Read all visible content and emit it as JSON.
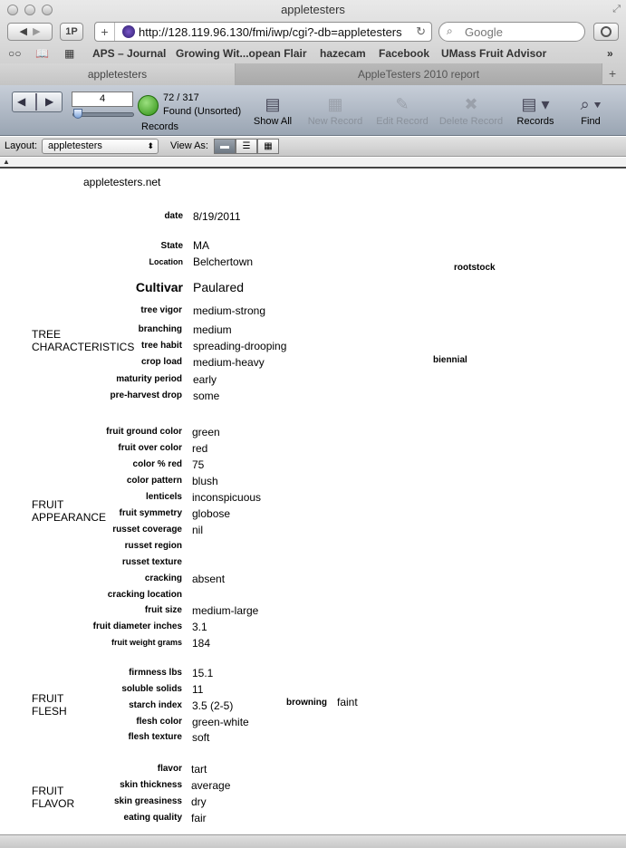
{
  "window": {
    "title": "appletesters"
  },
  "browser": {
    "address": "http://128.119.96.130/fmi/iwp/cgi?-db=appletesters",
    "search_placeholder": "Google",
    "password_button": "1P",
    "add_button": "+",
    "bookmarks": [
      "APS – Journal",
      "Growing Wit...opean Flair",
      "hazecam",
      "Facebook",
      "UMass Fruit Advisor"
    ],
    "tabs": [
      {
        "label": "appletesters",
        "active": true
      },
      {
        "label": "AppleTesters 2010 report",
        "active": false
      }
    ]
  },
  "toolbar": {
    "record_number": "4",
    "found": "72 / 317",
    "found_status": "Found (Unsorted)",
    "records_label": "Records",
    "buttons": [
      {
        "label": "Show All",
        "enabled": true
      },
      {
        "label": "New Record",
        "enabled": false
      },
      {
        "label": "Edit Record",
        "enabled": false
      },
      {
        "label": "Delete Record",
        "enabled": false
      },
      {
        "label": "Records",
        "enabled": true
      },
      {
        "label": "Find",
        "enabled": true
      }
    ]
  },
  "layout_bar": {
    "layout_label": "Layout:",
    "layout_value": "appletesters",
    "view_as_label": "View As:"
  },
  "record": {
    "site": "appletesters.net",
    "date_label": "date",
    "date": "8/19/2011",
    "state_label": "State",
    "state": "MA",
    "location_label": "Location",
    "location": "Belchertown",
    "rootstock_label": "rootstock",
    "cultivar_label": "Cultivar",
    "cultivar": "Paulared",
    "biennial_label": "biennial",
    "browning_label": "browning",
    "browning": "faint",
    "sections": {
      "tree": "TREE\nCHARACTERISTICS",
      "appearance": "FRUIT\nAPPEARANCE",
      "flesh": "FRUIT\nFLESH",
      "flavor": "FRUIT\nFLAVOR"
    },
    "tree": [
      {
        "label": "tree vigor",
        "value": "medium-strong"
      },
      {
        "label": "branching",
        "value": "medium"
      },
      {
        "label": "tree habit",
        "value": "spreading-drooping"
      },
      {
        "label": "crop load",
        "value": "medium-heavy"
      },
      {
        "label": "maturity period",
        "value": "early"
      },
      {
        "label": "pre-harvest drop",
        "value": "some"
      }
    ],
    "appearance": [
      {
        "label": "fruit ground color",
        "value": "green"
      },
      {
        "label": "fruit over color",
        "value": "red"
      },
      {
        "label": "color % red",
        "value": "75"
      },
      {
        "label": "color pattern",
        "value": "blush"
      },
      {
        "label": "lenticels",
        "value": "inconspicuous"
      },
      {
        "label": "fruit symmetry",
        "value": "globose"
      },
      {
        "label": "russet coverage",
        "value": "nil"
      },
      {
        "label": "russet region",
        "value": ""
      },
      {
        "label": "russet texture",
        "value": ""
      },
      {
        "label": "cracking",
        "value": "absent"
      },
      {
        "label": "cracking location",
        "value": ""
      },
      {
        "label": "fruit size",
        "value": "medium-large"
      },
      {
        "label": "fruit diameter inches",
        "value": "3.1"
      },
      {
        "label": "fruit weight grams",
        "value": "184"
      }
    ],
    "flesh": [
      {
        "label": "firmness lbs",
        "value": "15.1"
      },
      {
        "label": "soluble solids",
        "value": "11"
      },
      {
        "label": "starch index",
        "value": "3.5 (2-5)"
      },
      {
        "label": "flesh color",
        "value": "green-white"
      },
      {
        "label": "flesh texture",
        "value": "soft"
      }
    ],
    "flavor": [
      {
        "label": "flavor",
        "value": "tart"
      },
      {
        "label": "skin thickness",
        "value": "average"
      },
      {
        "label": "skin greasiness",
        "value": "dry"
      },
      {
        "label": "eating quality",
        "value": "fair"
      }
    ]
  }
}
